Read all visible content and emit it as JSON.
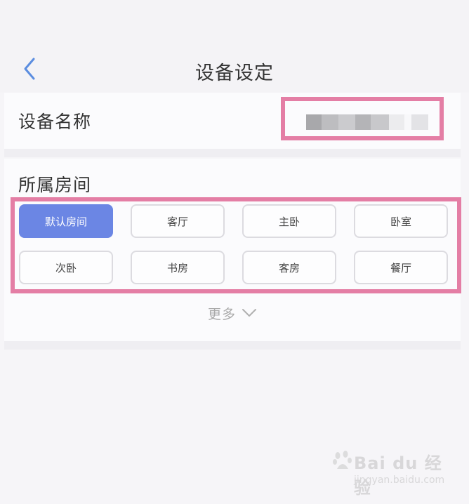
{
  "header": {
    "title": "设备设定",
    "back_icon": "chevron-left-icon",
    "accent_color": "#5b8de0"
  },
  "device_name": {
    "label": "设备名称",
    "value_blurred": true
  },
  "room": {
    "label": "所属房间",
    "selected": "默认房间",
    "options": [
      "默认房间",
      "客厅",
      "主卧",
      "卧室",
      "次卧",
      "书房",
      "客房",
      "餐厅"
    ],
    "selected_color": "#6b86e4"
  },
  "more": {
    "label": "更多",
    "icon": "chevron-down-icon"
  },
  "annotations": {
    "highlight_color": "#e47ea5"
  },
  "watermark": {
    "logo": "Bai du 经验",
    "url": "jingyan.baidu.com"
  }
}
